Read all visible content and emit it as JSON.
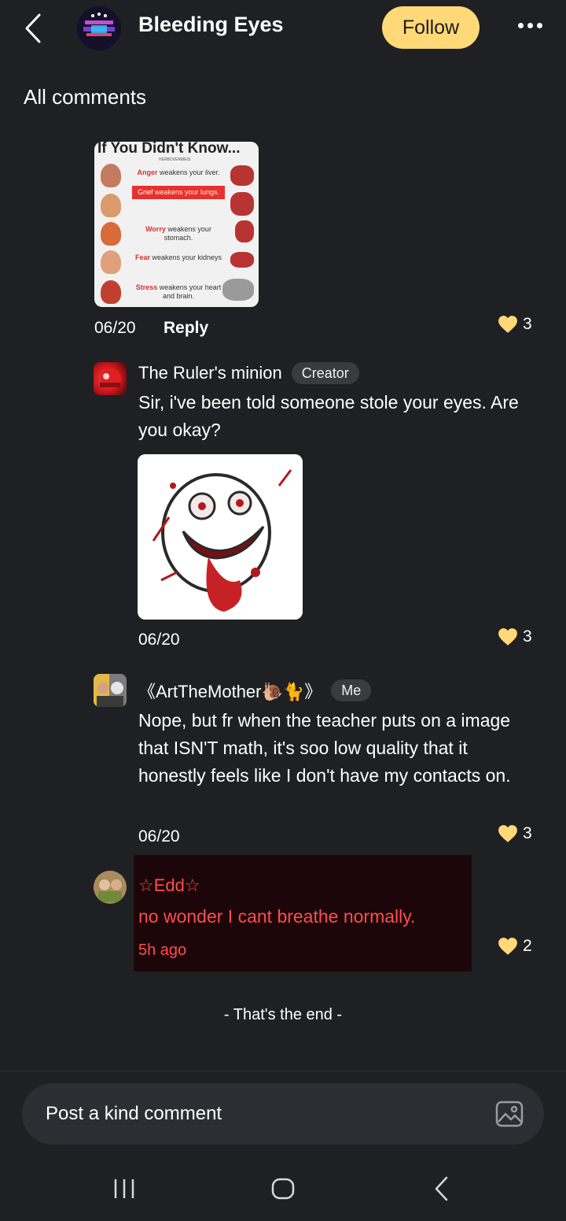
{
  "header": {
    "title": "Bleeding Eyes",
    "follow_label": "Follow",
    "back_icon": "chevron-left-icon",
    "more_icon": "more-dots-icon"
  },
  "section_title": "All comments",
  "comments": [
    {
      "image": {
        "title": "If You Didn't Know...",
        "subtitle": "HERBOVERMEIS",
        "rows": [
          {
            "bold": "Anger",
            "text": " weakens your liver."
          },
          {
            "bold": "Grief",
            "text": " weakens your lungs."
          },
          {
            "bold": "Worry",
            "text": " weakens your stomach."
          },
          {
            "bold": "Fear",
            "text": " weakens your kidneys"
          },
          {
            "bold": "Stress",
            "text": " weakens your heart and brain."
          }
        ]
      },
      "date": "06/20",
      "reply_label": "Reply",
      "likes": "3"
    },
    {
      "author": "The Ruler's minion",
      "badge": "Creator",
      "text": "Sir, i've been told someone stole your eyes. Are you okay?",
      "date": "06/20",
      "likes": "3"
    },
    {
      "author": "《ArtTheMother🐌🐈》",
      "badge": "Me",
      "text": "Nope, but fr when the teacher puts on a image that ISN'T math, it's soo low quality that it honestly feels like I don't have my contacts on.",
      "date": "06/20",
      "likes": "3"
    },
    {
      "author": "☆Edd☆",
      "text": "no wonder I cant breathe normally.",
      "time": "5h ago",
      "likes": "2"
    }
  ],
  "end_text": "- That's the end -",
  "composer": {
    "placeholder": "Post a kind comment",
    "image_icon": "image-icon"
  },
  "colors": {
    "background": "#1f2024",
    "follow_button": "#ffd878",
    "like_heart": "#ffd878",
    "highlight_text": "#ff4d4d",
    "highlight_bg": "#1d0609"
  }
}
